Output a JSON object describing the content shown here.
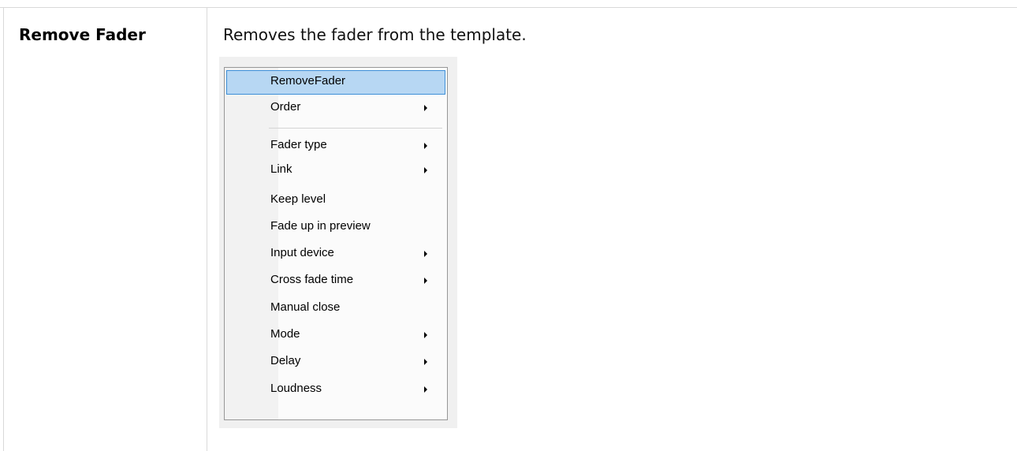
{
  "row": {
    "term": "Remove Fader",
    "description": "Removes the fader from the template."
  },
  "context_menu": {
    "items": [
      {
        "label": "RemoveFader",
        "has_submenu": false,
        "highlighted": true
      },
      {
        "label": "Order",
        "has_submenu": true
      },
      {
        "label": "Fader type",
        "has_submenu": true
      },
      {
        "label": "Link",
        "has_submenu": true
      },
      {
        "label": "Keep level",
        "has_submenu": false
      },
      {
        "label": "Fade up in preview",
        "has_submenu": false
      },
      {
        "label": "Input device",
        "has_submenu": true
      },
      {
        "label": "Cross fade time",
        "has_submenu": true
      },
      {
        "label": "Manual close",
        "has_submenu": false
      },
      {
        "label": "Mode",
        "has_submenu": true
      },
      {
        "label": "Delay",
        "has_submenu": true
      },
      {
        "label": "Loudness",
        "has_submenu": true
      }
    ],
    "colors": {
      "highlight_fill": "#b7d7f3",
      "highlight_border": "#3d8fd8"
    }
  }
}
